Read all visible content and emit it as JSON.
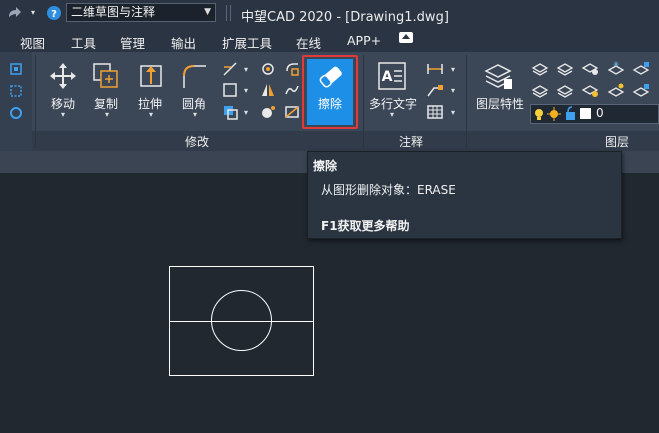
{
  "titlebar": {
    "workspace": "二维草图与注释",
    "title": "中望CAD 2020 - [Drawing1.dwg]"
  },
  "menu": {
    "items": [
      "视图",
      "工具",
      "管理",
      "输出",
      "扩展工具",
      "在线",
      "APP+"
    ]
  },
  "ribbon": {
    "modify": {
      "title": "修改",
      "move": "移动",
      "copy": "复制",
      "stretch": "拉伸",
      "fillet": "圆角",
      "erase": "擦除"
    },
    "annotate": {
      "title": "注释",
      "mtext": "多行文字"
    },
    "layers": {
      "title": "图层",
      "properties": "图层特性",
      "current_layer": "0"
    }
  },
  "tooltip": {
    "title": "擦除",
    "description": "从图形删除对象：ERASE",
    "help": "F1获取更多帮助"
  },
  "colors": {
    "accent": "#1e8fe6",
    "highlight": "#e13a3a",
    "canvas": "#212830",
    "ribbon": "#3b4656"
  }
}
